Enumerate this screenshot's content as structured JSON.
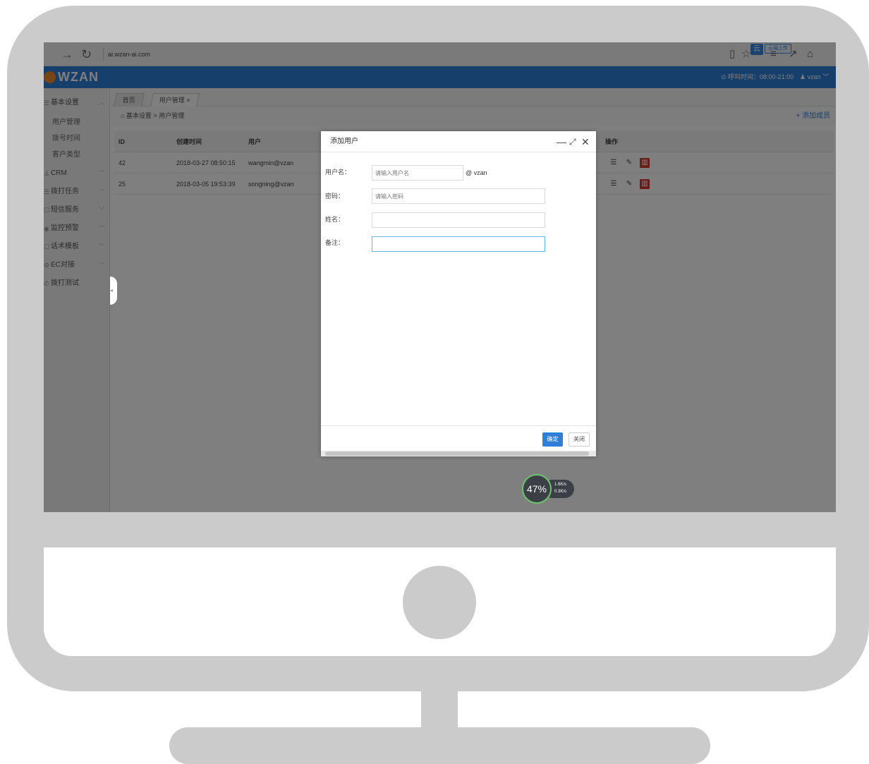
{
  "browser": {
    "url": "ai.wzan-ai.com",
    "upload_label": "云端上传",
    "badge": "云"
  },
  "header": {
    "logo_text": "WZAN",
    "call_time": "⊙ 呼叫时间：08:00-21:00",
    "user": "♟ vzan ﹀"
  },
  "sidebar": {
    "items": [
      {
        "icon": "☰",
        "label": "基本设置",
        "chev": "︿"
      },
      {
        "icon": "♙",
        "label": "CRM",
        "chev": "﹀"
      },
      {
        "icon": "☰",
        "label": "拨打任务",
        "chev": "﹀"
      },
      {
        "icon": "☐",
        "label": "短信服务",
        "chev": "﹀"
      },
      {
        "icon": "◉",
        "label": "监控预警",
        "chev": "﹀"
      },
      {
        "icon": "☐",
        "label": "话术模板",
        "chev": "﹀"
      },
      {
        "icon": "⚙",
        "label": "EC对接",
        "chev": "﹀"
      },
      {
        "icon": "✆",
        "label": "拨打测试",
        "chev": ""
      }
    ],
    "sub_items": [
      "用户管理",
      "拨号时间",
      "客户类型"
    ]
  },
  "tabs": [
    {
      "label": "首页"
    },
    {
      "label": "用户管理 ×"
    }
  ],
  "breadcrumb": "⌂ 基本设置 > 用户管理",
  "add_member": "+ 添加成员",
  "table": {
    "headers": [
      "ID",
      "创建时间",
      "用户",
      "操作"
    ],
    "rows": [
      {
        "id": "42",
        "created": "2018-03-27 08:50:15",
        "user": "wangmin@vzan"
      },
      {
        "id": "25",
        "created": "2018-03-05 19:53:39",
        "user": "songning@vzan"
      }
    ]
  },
  "dialog": {
    "title": "添加用户",
    "fields": [
      {
        "label": "用户名：",
        "placeholder": "请输入用户名",
        "suffix": "@ vzan"
      },
      {
        "label": "密码：",
        "placeholder": "请输入密码"
      },
      {
        "label": "姓名：",
        "placeholder": ""
      },
      {
        "label": "备注：",
        "placeholder": ""
      }
    ],
    "ok": "确定",
    "close": "关闭"
  },
  "speed_widget": {
    "percent": "47%",
    "up": "1.6K/s",
    "down": "0.3K/s"
  },
  "colors": {
    "brand_blue": "#2f7ed8",
    "delete_red": "#d9392e",
    "logo_orange": "#f08a2c"
  }
}
